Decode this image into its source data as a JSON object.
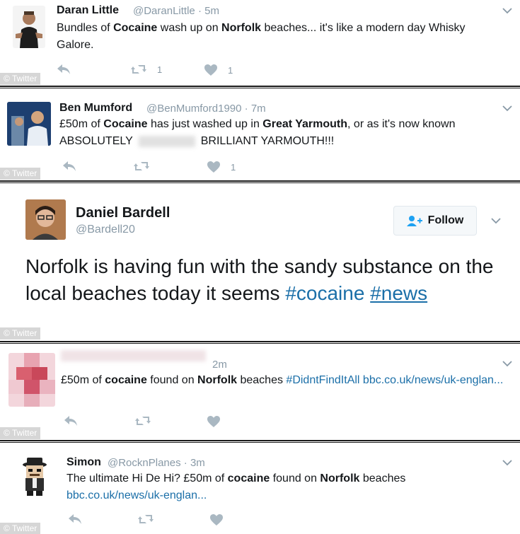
{
  "watermark": "Twitter",
  "tweets": [
    {
      "name": "Daran Little",
      "handle": "@DaranLittle",
      "time": "5m",
      "text_parts": [
        {
          "t": "Bundles of ",
          "b": false
        },
        {
          "t": "Cocaine",
          "b": true
        },
        {
          "t": " wash up on ",
          "b": false
        },
        {
          "t": "Norfolk",
          "b": true
        },
        {
          "t": " beaches... it's like a modern day Whisky Galore.",
          "b": false
        }
      ],
      "retweets": "1",
      "likes": "1"
    },
    {
      "name": "Ben Mumford",
      "handle": "@BenMumford1990",
      "time": "7m",
      "text_parts": [
        {
          "t": "£50m of ",
          "b": false
        },
        {
          "t": "Cocaine",
          "b": true
        },
        {
          "t": " has just washed up in ",
          "b": false
        },
        {
          "t": "Great Yarmouth",
          "b": true
        },
        {
          "t": ", or as it's now known ABSOLUTELY",
          "b": false
        }
      ],
      "text_after_redaction": "BRILLIANT YARMOUTH!!!",
      "likes": "1"
    },
    {
      "name": "Daniel Bardell",
      "handle": "@Bardell20",
      "follow_label": "Follow",
      "text": "Norfolk is having fun with the sandy substance on the local beaches today it seems",
      "hashtags": [
        "#cocaine",
        "#news"
      ]
    },
    {
      "time": "2m",
      "text_parts": [
        {
          "t": "£50m of ",
          "b": false
        },
        {
          "t": "cocaine",
          "b": true
        },
        {
          "t": " found on ",
          "b": false
        },
        {
          "t": "Norfolk",
          "b": true
        },
        {
          "t": " beaches ",
          "b": false
        }
      ],
      "hashtag": "#DidntFindItAll",
      "link": "bbc.co.uk/news/uk-englan..."
    },
    {
      "name": "Simon",
      "handle": "@RocknPlanes",
      "time": "3m",
      "text_parts": [
        {
          "t": "The ultimate Hi De Hi? £50m of ",
          "b": false
        },
        {
          "t": "cocaine",
          "b": true
        },
        {
          "t": " found on ",
          "b": false
        },
        {
          "t": "Norfolk",
          "b": true
        },
        {
          "t": " beaches",
          "b": false
        }
      ],
      "link": "bbc.co.uk/news/uk-englan..."
    }
  ],
  "colors": {
    "link": "#1b6fa8",
    "muted": "#8899a6",
    "icon": "#aab8c2"
  }
}
